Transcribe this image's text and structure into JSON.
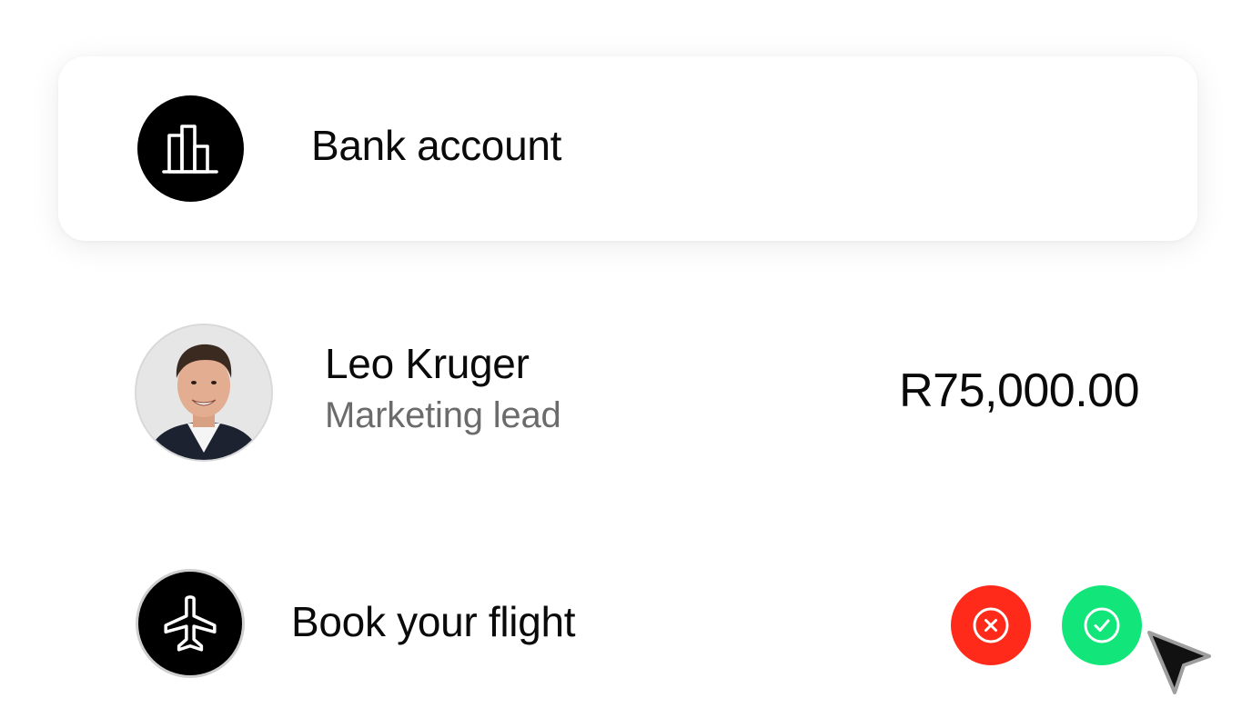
{
  "bank": {
    "label": "Bank account",
    "icon": "bar-chart-icon"
  },
  "person": {
    "name": "Leo Kruger",
    "role": "Marketing lead",
    "amount": "R75,000.00",
    "avatar": "avatar-photo"
  },
  "flight": {
    "label": "Book your flight",
    "icon": "airplane-icon"
  },
  "actions": {
    "reject_icon": "close-icon",
    "accept_icon": "check-icon"
  },
  "colors": {
    "reject": "#ff2a1a",
    "accept": "#12e57a",
    "icon_bg": "#000000",
    "secondary_text": "#6b6b6b"
  }
}
